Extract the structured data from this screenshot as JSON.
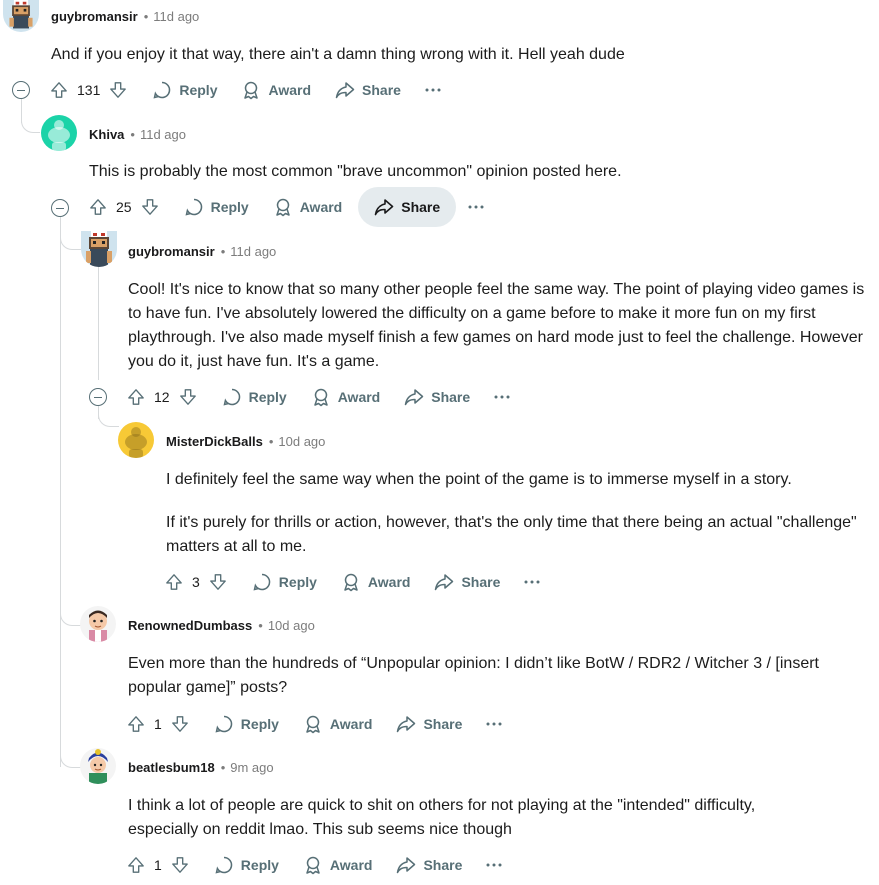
{
  "labels": {
    "reply": "Reply",
    "award": "Award",
    "share": "Share",
    "sep": "•"
  },
  "comments": [
    {
      "author": "guybromansir",
      "time": "11d ago",
      "body": [
        "And if you enjoy it that way, there ain't a damn thing wrong with it. Hell yeah dude"
      ],
      "votes": "131"
    },
    {
      "author": "Khiva",
      "time": "11d ago",
      "body": [
        "This is probably the most common \"brave uncommon\" opinion posted here."
      ],
      "votes": "25"
    },
    {
      "author": "guybromansir",
      "time": "11d ago",
      "body": [
        "Cool! It's nice to know that so many other people feel the same way. The point of playing video games is to have fun. I've absolutely lowered the difficulty on a game before to make it more fun on my first playthrough. I've also made myself finish a few games on hard mode just to feel the challenge. However you do it, just have fun. It's a game."
      ],
      "votes": "12"
    },
    {
      "author": "MisterDickBalls",
      "time": "10d ago",
      "body": [
        "I definitely feel the same way when the point of the game is to immerse myself in a story.",
        "If it's purely for thrills or action, however, that's the only time that there being an actual \"challenge\" matters at all to me."
      ],
      "votes": "3"
    },
    {
      "author": "RenownedDumbass",
      "time": "10d ago",
      "body": [
        "Even more than the hundreds of “Unpopular opinion: I didn’t like BotW / RDR2 / Witcher 3 / [insert popular game]” posts?"
      ],
      "votes": "1"
    },
    {
      "author": "beatlesbum18",
      "time": "9m ago",
      "body": [
        "I think a lot of people are quick to shit on others for not playing at the \"intended\" difficulty, especially on reddit lmao. This sub seems nice though"
      ],
      "votes": "1"
    }
  ],
  "colors": {
    "khiva_avatar": "#1bd3a8",
    "misterdickballs_avatar": "#f7c936",
    "share_active_bg": "#e5ebee"
  }
}
